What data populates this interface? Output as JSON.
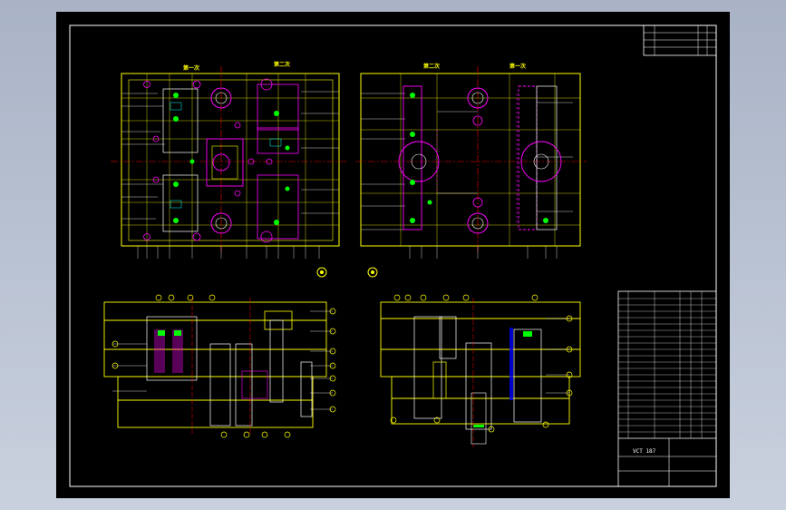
{
  "views": {
    "top_left_a": "第一次",
    "top_left_b": "第二次",
    "top_right_a": "第二次",
    "top_right_b": "第一次"
  },
  "title_block": {
    "drawing_no": "VCT 187"
  },
  "colors": {
    "background": "#000000",
    "frame": "#ffffff",
    "outline": "#ffff00",
    "centerline": "#ff0000",
    "hole_magenta": "#ff00ff",
    "hole_green": "#00ff00",
    "blue": "#0000ff",
    "cyan": "#00ffff"
  },
  "icons": [
    "rotation-symbol-icon",
    "rotation-symbol-icon"
  ]
}
